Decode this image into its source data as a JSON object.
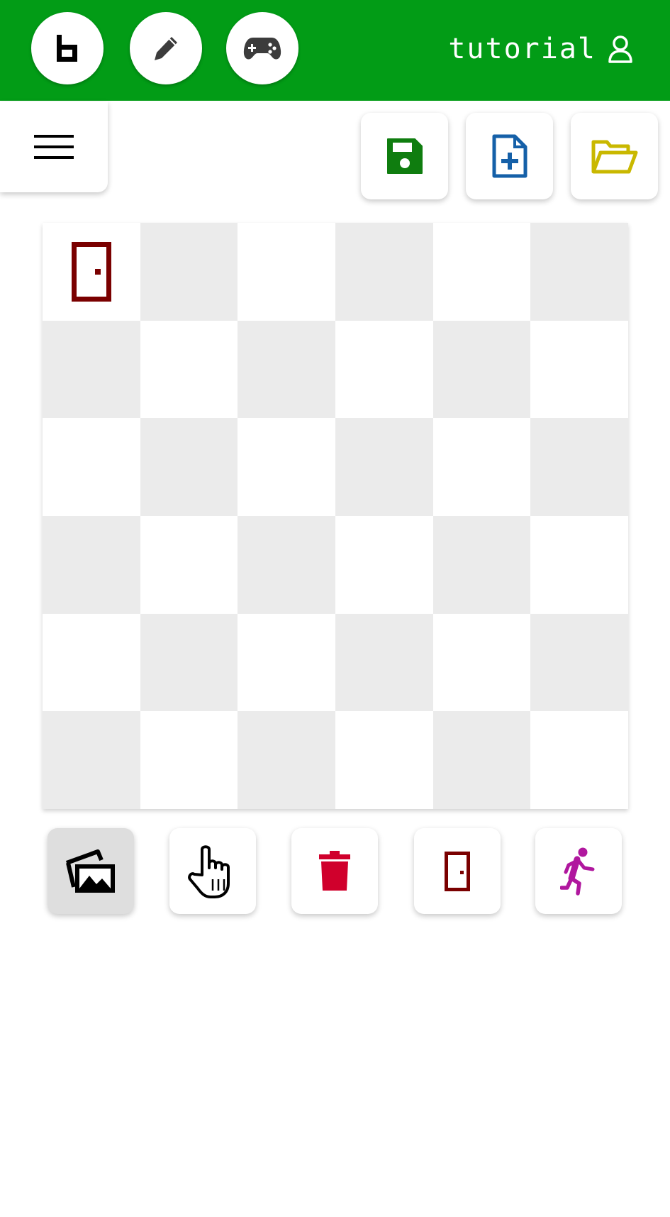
{
  "header": {
    "username": "tutorial",
    "background": "#029c16",
    "nav_buttons": [
      {
        "icon": "logo-b-icon"
      },
      {
        "icon": "pencil-icon"
      },
      {
        "icon": "gamepad-icon"
      }
    ],
    "user_icon": "user-icon"
  },
  "toolbar": {
    "menu_icon": "hamburger-menu-icon",
    "actions": [
      {
        "icon": "save-icon",
        "color": "#0f7d0f"
      },
      {
        "icon": "new-file-icon",
        "color": "#1560a8"
      },
      {
        "icon": "open-folder-icon",
        "color": "#c9b800"
      }
    ]
  },
  "board": {
    "rows": 6,
    "cols": 6,
    "light_color": "#ffffff",
    "dark_color": "#ebebeb",
    "placed": [
      {
        "row": 0,
        "col": 0,
        "item": "door-icon",
        "color": "#7a0000"
      }
    ]
  },
  "tools": [
    {
      "icon": "images-icon",
      "selected": true
    },
    {
      "icon": "pointing-hand-icon",
      "selected": false
    },
    {
      "icon": "trash-icon",
      "selected": false,
      "color": "#d0002c"
    },
    {
      "icon": "door-icon",
      "selected": false,
      "color": "#7a0000"
    },
    {
      "icon": "running-person-icon",
      "selected": false,
      "color": "#b0179e"
    }
  ]
}
